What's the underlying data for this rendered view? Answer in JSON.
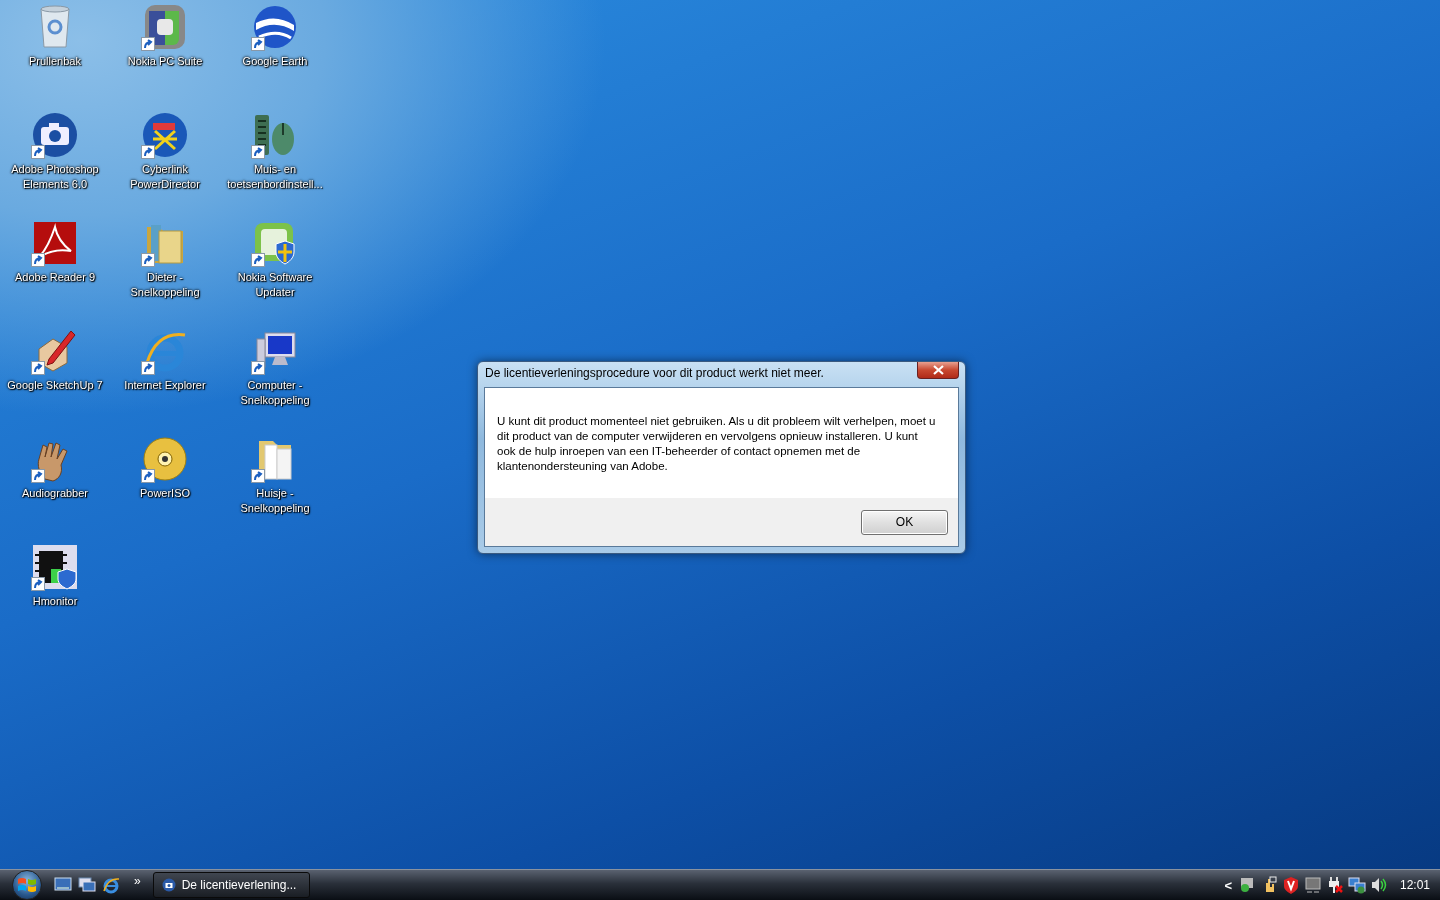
{
  "desktop_icons": [
    {
      "label": "Prullenbak",
      "shortcut": false
    },
    {
      "label": "Nokia PC Suite",
      "shortcut": true
    },
    {
      "label": "Google Earth",
      "shortcut": true
    },
    {
      "label": "Adobe Photoshop Elements 6.0",
      "shortcut": true
    },
    {
      "label": "Cyberlink PowerDirector",
      "shortcut": true
    },
    {
      "label": "Muis- en toetsenbordinstell...",
      "shortcut": true
    },
    {
      "label": "Adobe Reader 9",
      "shortcut": true
    },
    {
      "label": "Dieter - Snelkoppeling",
      "shortcut": true
    },
    {
      "label": "Nokia Software Updater",
      "shortcut": true
    },
    {
      "label": "Google SketchUp 7",
      "shortcut": true
    },
    {
      "label": "Internet Explorer",
      "shortcut": true
    },
    {
      "label": "Computer - Snelkoppeling",
      "shortcut": true
    },
    {
      "label": "Audiograbber",
      "shortcut": true
    },
    {
      "label": "PowerISO",
      "shortcut": true
    },
    {
      "label": "Huisje - Snelkoppeling",
      "shortcut": true
    },
    {
      "label": "Hmonitor",
      "shortcut": true
    }
  ],
  "dialog": {
    "title": "De licentieverleningsprocedure voor dit product werkt niet meer.",
    "message": "U kunt dit product momenteel niet gebruiken. Als u dit probleem wilt verhelpen, moet u dit product van de computer verwijderen en vervolgens opnieuw installeren. U kunt ook de hulp inroepen van een IT-beheerder of contact opnemen met de klantenondersteuning van Adobe.",
    "buttons": [
      "OK"
    ]
  },
  "taskbar": {
    "quick_launch_more": "»",
    "tasks": [
      {
        "label": "De licentieverlening...",
        "selected": false
      }
    ],
    "tray_expand": "<",
    "clock": "12:01"
  }
}
